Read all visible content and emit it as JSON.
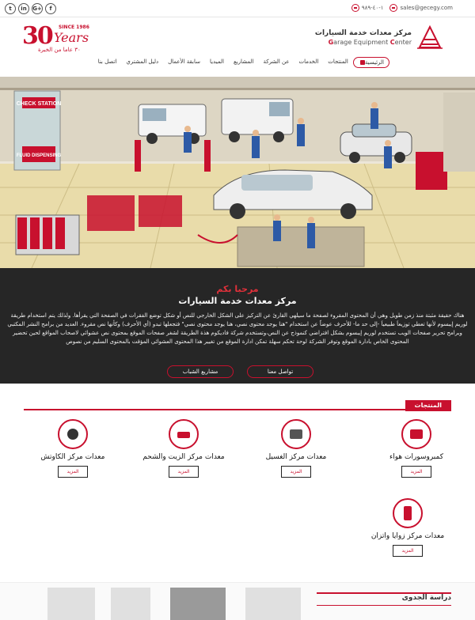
{
  "topbar": {
    "social": [
      "f",
      "G+",
      "in",
      "t"
    ],
    "phone": "١-٤٠-٩٨٩",
    "email": "sales@gecegy.com"
  },
  "brand": {
    "name_ar": "مركز معدات خدمة السيارات",
    "name_en_prefix": "G",
    "name_en_rest": "arage Equipment ",
    "name_en_c": "C",
    "name_en_end": "enter",
    "anniv_number": "30",
    "anniv_since": "SINCE 1986",
    "anniv_years": "Years",
    "anniv_ar": "٣٠ عاما من الخبرة"
  },
  "nav": {
    "items": [
      "الرئيسية",
      "المنتجات",
      "الخدمات",
      "عن الشركة",
      "المشاريع",
      "الميديا",
      "سابقة الأعمال",
      "دليل المشتري",
      "اتصل بنا"
    ]
  },
  "hero": {
    "sign_check": "CHECK STATION",
    "sign_fluid": "FLUID DISPENSING",
    "welcome": "مرحبا بكم",
    "title": "مركز معدات خدمة السيارات",
    "body": "هناك حقيقة مثبتة منذ زمن طويل وهي أن المحتوى المقروء لصفحة ما سيلهي القارئ عن التركيز على الشكل الخارجي للنص أو شكل توضع الفقرات في الصفحة التي يقرأها. ولذلك يتم استخدام طريقة لوريم إيبسوم لأنها تعطي توزيعاَ طبيعياَ -إلى حد ما- للأحرف عوضاً عن استخدام \"هنا يوجد محتوى نصي، هنا يوجد محتوى نصي\" فتجعلها تبدو (أي الأحرف) وكأنها نص مقروء. العديد من برامح النشر المكتبي وبرامح تحرير صفحات الويب تستخدم لوريم إيبسوم بشكل افتراضي كنموذج عن النص،وتستخدم شركة فاديكوم هذة الطريقة لشغر صفحات الموقع بمحتوى نص عشوائي لاصحاب المواقع لحين تحضير المحتوى الخاص بادارة الموقع وتوفر الشركة لوحة تحكم سهلة تمكن ادارة الموقع من تغيير هذا المحتوى العشوائي المؤقت بالمحتوى السليم من نصوص",
    "btn_contact": "تواصل معنا",
    "btn_projects": "مشاريع الشباب"
  },
  "products": {
    "section_title": "المنتجات",
    "more_label": "المزيد",
    "items": [
      {
        "name": "كمبروسورات هواء",
        "icon": "air-compressor-icon"
      },
      {
        "name": "معدات مركز الغسيل",
        "icon": "washer-icon"
      },
      {
        "name": "معدات مركز الزيت والشحم",
        "icon": "lift-icon"
      },
      {
        "name": "معدات مركز الكاوتش",
        "icon": "tire-changer-icon"
      },
      {
        "name": "معدات مركز زوايا واتزان",
        "icon": "balancer-icon"
      }
    ]
  },
  "feasibility": {
    "title": "دراسة الجدوى"
  },
  "colors": {
    "accent": "#c8102e",
    "dark": "#262626"
  }
}
